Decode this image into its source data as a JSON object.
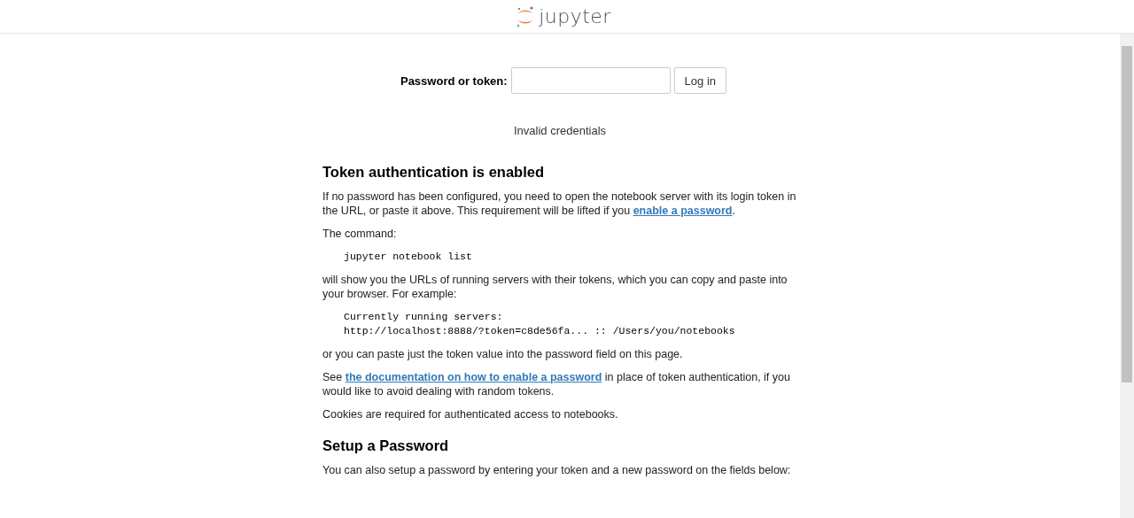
{
  "header": {
    "logo_text": "jupyter"
  },
  "login": {
    "label": "Password or token:",
    "button": "Log in"
  },
  "message": "Invalid credentials",
  "sections": [
    {
      "heading": "Token authentication is enabled",
      "blocks": [
        {
          "kind": "text",
          "text": "If no password has been configured, you need to open the notebook server with its login token in the URL, or paste it above. This requirement will be lifted if you ",
          "link": "enable a password",
          "after": "."
        },
        {
          "kind": "text",
          "text": "The command:"
        },
        {
          "kind": "code",
          "lines": [
            "jupyter notebook list"
          ]
        },
        {
          "kind": "text",
          "text": "will show you the URLs of running servers with their tokens, which you can copy and paste into your browser. For example:"
        },
        {
          "kind": "code",
          "lines": [
            "Currently running servers:",
            "http://localhost:8888/?token=c8de56fa... :: /Users/you/notebooks"
          ]
        },
        {
          "kind": "text",
          "text": "or you can paste just the token value into the password field on this page."
        },
        {
          "kind": "text",
          "text": "See ",
          "link": "the documentation on how to enable a password",
          "after": " in place of token authentication, if you would like to avoid dealing with random tokens."
        },
        {
          "kind": "text",
          "text": "Cookies are required for authenticated access to notebooks."
        }
      ]
    },
    {
      "heading": "Setup a Password",
      "blocks": [
        {
          "kind": "text",
          "text": "You can also setup a password by entering your token and a new password on the fields below:"
        }
      ]
    }
  ]
}
